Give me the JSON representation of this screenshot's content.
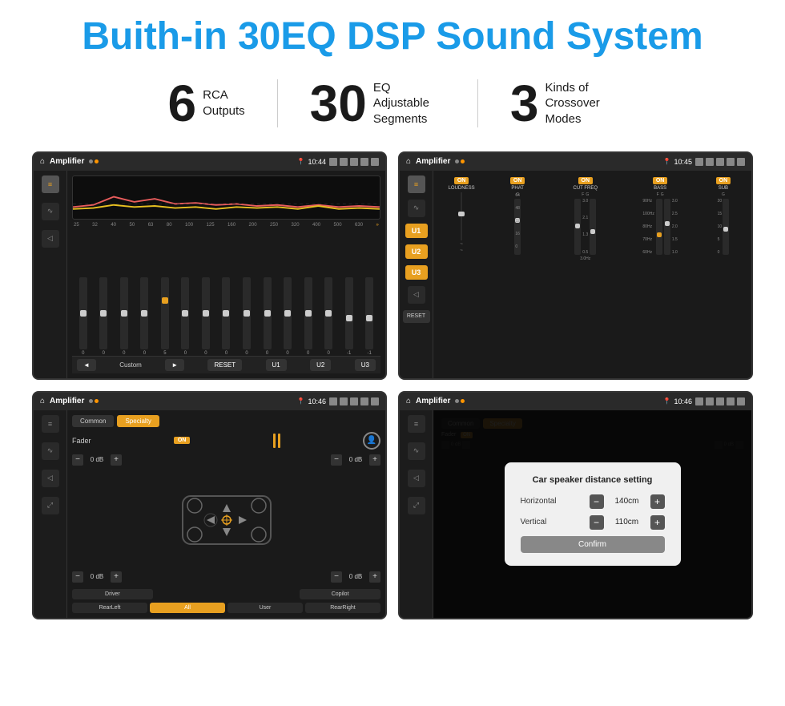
{
  "header": {
    "title": "Buith-in 30EQ DSP Sound System",
    "title_prefix": "Buith-in ",
    "title_highlight": "30EQ DSP",
    "title_suffix": " Sound System"
  },
  "stats": [
    {
      "number": "6",
      "label_line1": "RCA",
      "label_line2": "Outputs"
    },
    {
      "number": "30",
      "label_line1": "EQ Adjustable",
      "label_line2": "Segments"
    },
    {
      "number": "3",
      "label_line1": "Kinds of",
      "label_line2": "Crossover Modes"
    }
  ],
  "screens": [
    {
      "id": "eq-screen",
      "status_bar": {
        "app_name": "Amplifier",
        "time": "10:44",
        "indicators": [
          "play",
          "location",
          "camera",
          "volume",
          "x",
          "battery",
          "back"
        ]
      },
      "eq_frequencies": [
        "25",
        "32",
        "40",
        "50",
        "63",
        "80",
        "100",
        "125",
        "160",
        "200",
        "250",
        "320",
        "400",
        "500",
        "630"
      ],
      "eq_sliders": [
        {
          "value": "0",
          "pos": 50
        },
        {
          "value": "0",
          "pos": 50
        },
        {
          "value": "0",
          "pos": 50
        },
        {
          "value": "0",
          "pos": 45
        },
        {
          "value": "5",
          "pos": 30
        },
        {
          "value": "0",
          "pos": 50
        },
        {
          "value": "0",
          "pos": 50
        },
        {
          "value": "0",
          "pos": 50
        },
        {
          "value": "0",
          "pos": 50
        },
        {
          "value": "0",
          "pos": 50
        },
        {
          "value": "0",
          "pos": 50
        },
        {
          "value": "0",
          "pos": 50
        },
        {
          "value": "0",
          "pos": 50
        },
        {
          "value": "-1",
          "pos": 55
        },
        {
          "value": "-1",
          "pos": 55
        }
      ],
      "bottom_buttons": [
        "◄",
        "Custom",
        "►",
        "RESET",
        "U1",
        "U2",
        "U3"
      ]
    },
    {
      "id": "crossover-screen",
      "status_bar": {
        "app_name": "Amplifier",
        "time": "10:45"
      },
      "u_buttons": [
        "U1",
        "U2",
        "U3"
      ],
      "channels": [
        {
          "label": "LOUDNESS",
          "on": true
        },
        {
          "label": "PHAT",
          "on": true
        },
        {
          "label": "CUT FREQ",
          "on": true
        },
        {
          "label": "BASS",
          "on": true
        },
        {
          "label": "SUB",
          "on": true
        }
      ]
    },
    {
      "id": "fader-screen",
      "status_bar": {
        "app_name": "Amplifier",
        "time": "10:46"
      },
      "tabs": [
        "Common",
        "Specialty"
      ],
      "active_tab": "Specialty",
      "fader_label": "Fader",
      "fader_on": "ON",
      "vol_controls": [
        {
          "label": "0 dB",
          "side": "left-top"
        },
        {
          "label": "0 dB",
          "side": "right-top"
        },
        {
          "label": "0 dB",
          "side": "left-bottom"
        },
        {
          "label": "0 dB",
          "side": "right-bottom"
        }
      ],
      "bottom_buttons": [
        {
          "label": "Driver",
          "active": false
        },
        {
          "label": "RearLeft",
          "active": false
        },
        {
          "label": "All",
          "active": true
        },
        {
          "label": "User",
          "active": false
        },
        {
          "label": "Copilot",
          "active": false
        },
        {
          "label": "RearRight",
          "active": false
        }
      ]
    },
    {
      "id": "dialog-screen",
      "status_bar": {
        "app_name": "Amplifier",
        "time": "10:46"
      },
      "dialog": {
        "title": "Car speaker distance setting",
        "rows": [
          {
            "label": "Horizontal",
            "value": "140cm"
          },
          {
            "label": "Vertical",
            "value": "110cm"
          }
        ],
        "confirm_label": "Confirm"
      }
    }
  ]
}
